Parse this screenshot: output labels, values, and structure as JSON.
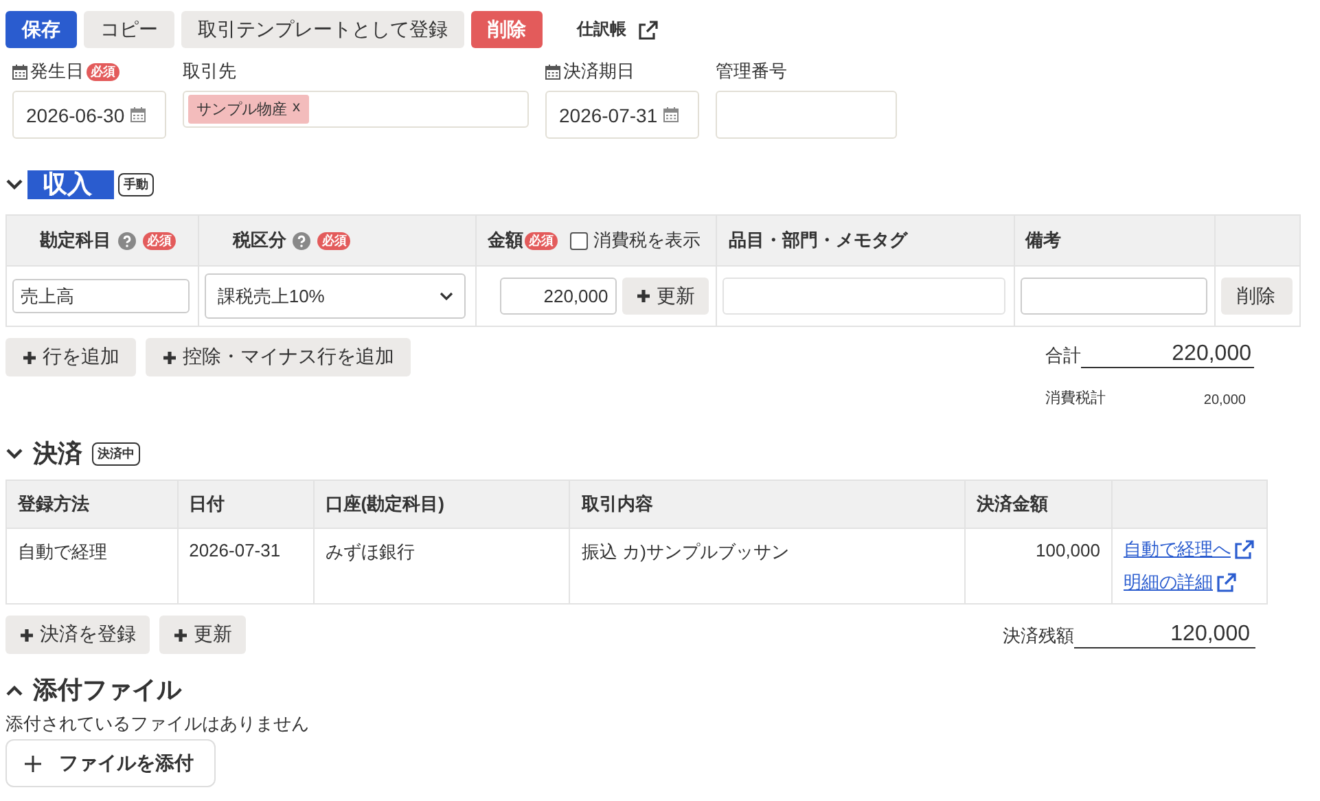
{
  "toolbar": {
    "buttons": [
      {
        "label": "保存",
        "kind": "primary"
      },
      {
        "label": "コピー",
        "kind": "default"
      },
      {
        "label": "取引テンプレートとして登録",
        "kind": "default"
      },
      {
        "label": "削除",
        "kind": "danger"
      }
    ],
    "journal_link": "仕訳帳"
  },
  "header_fields": [
    {
      "label": "発生日",
      "kind": "date",
      "badge": "必須",
      "value": "2026-06-30"
    },
    {
      "label": "取引先",
      "kind": "tags",
      "tags": [
        {
          "label": "サンプル物産",
          "remove": "x"
        }
      ]
    },
    {
      "label": "決済期日",
      "kind": "date",
      "value": "2026-07-31"
    },
    {
      "label": "管理番号",
      "kind": "text"
    }
  ],
  "income": {
    "title": "収入",
    "badge": "手動",
    "expanded": true,
    "columns": [
      {
        "label": "勘定科目",
        "help": true,
        "badge": "必須"
      },
      {
        "label": "税区分",
        "help": true,
        "badge": "必須"
      },
      {
        "label": "金額",
        "badge": "必須",
        "checkbox": {
          "label": "消費税を表示",
          "checked": false
        }
      },
      {
        "label": "品目・部門・メモタグ"
      },
      {
        "label": "備考"
      }
    ],
    "rows": [
      {
        "account": "売上高",
        "tax": "課税売上10%",
        "amount": "220,000",
        "update": "更新",
        "delete": "削除"
      }
    ],
    "buttons": [
      "行を追加",
      "控除・マイナス行を追加"
    ],
    "totals": [
      {
        "label": "合計",
        "value": "220,000",
        "kind": "total"
      },
      {
        "label": "消費税計",
        "value": "20,000",
        "kind": "tax"
      }
    ]
  },
  "settlement": {
    "title": "決済",
    "badge": "決済中",
    "expanded": true,
    "columns": [
      "登録方法",
      "日付",
      "口座(勘定科目)",
      "取引内容",
      "決済金額"
    ],
    "rows": [
      {
        "cells": [
          "自動で経理",
          "2026-07-31",
          "みずほ銀行",
          "振込 カ)サンプルブッサン",
          "100,000"
        ],
        "links": [
          "自動で経理へ",
          "明細の詳細"
        ]
      }
    ],
    "buttons": [
      "決済を登録",
      "更新"
    ],
    "balance": {
      "label": "決済残額",
      "value": "120,000"
    }
  },
  "attachments": {
    "title": "添付ファイル",
    "expanded": false,
    "message": "添付されているファイルはありません",
    "button": "ファイルを添付"
  }
}
